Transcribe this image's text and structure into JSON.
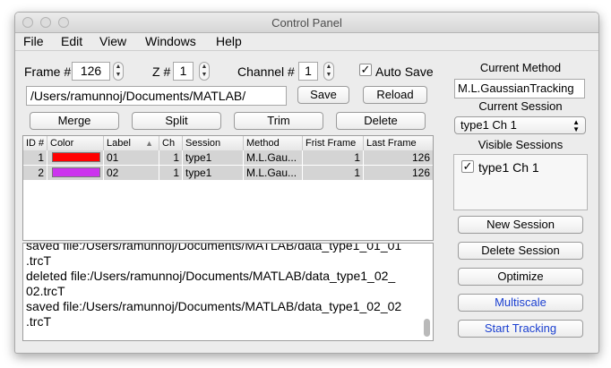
{
  "window": {
    "title": "Control Panel"
  },
  "menu": [
    "File",
    "Edit",
    "View",
    "Windows",
    "Help"
  ],
  "controls": {
    "frame_label": "Frame #",
    "frame_value": "126",
    "z_label": "Z #",
    "z_value": "1",
    "channel_label": "Channel #",
    "channel_value": "1",
    "auto_save_label": "Auto Save",
    "auto_save_checked": true,
    "path_value": "/Users/ramunnoj/Documents/MATLAB/",
    "save_label": "Save",
    "reload_label": "Reload",
    "merge_label": "Merge",
    "split_label": "Split",
    "trim_label": "Trim",
    "delete_label": "Delete"
  },
  "table": {
    "columns": [
      "ID #",
      "Color",
      "Label",
      "Ch",
      "Session",
      "Method",
      "Frist Frame",
      "Last Frame"
    ],
    "rows": [
      {
        "id": "1",
        "color": "#ff0000",
        "label": "01",
        "ch": "1",
        "session": "type1",
        "method": "M.L.Gau...",
        "first": "1",
        "last": "126"
      },
      {
        "id": "2",
        "color": "#cc33ee",
        "label": "02",
        "ch": "1",
        "session": "type1",
        "method": "M.L.Gau...",
        "first": "1",
        "last": "126"
      }
    ]
  },
  "log": {
    "lines": [
      "saved file:/Users/ramunnoj/Documents/MATLAB/data_type1_01_01",
      ".trcT",
      "deleted file:/Users/ramunnoj/Documents/MATLAB/data_type1_02_",
      "02.trcT",
      "saved file:/Users/ramunnoj/Documents/MATLAB/data_type1_02_02",
      ".trcT"
    ]
  },
  "right_panel": {
    "current_method_label": "Current Method",
    "current_method_value": "M.L.GaussianTracking",
    "current_session_label": "Current Session",
    "current_session_value": "type1 Ch 1",
    "visible_sessions_label": "Visible Sessions",
    "visible_sessions": [
      {
        "label": "type1 Ch 1",
        "checked": true
      }
    ],
    "new_session_label": "New Session",
    "delete_session_label": "Delete Session",
    "optimize_label": "Optimize",
    "multiscale_label": "Multiscale",
    "start_tracking_label": "Start Tracking"
  },
  "colors": {
    "accent_blue": "#1a3fd0",
    "row_bg": "#d4d4d4"
  }
}
